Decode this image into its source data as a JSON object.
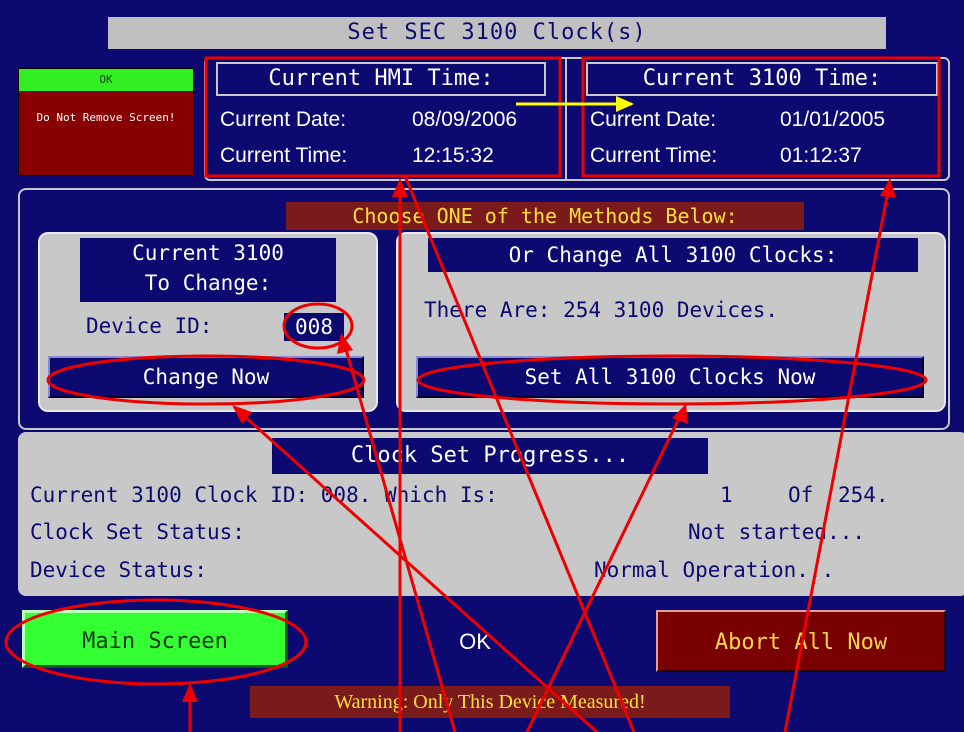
{
  "title": "Set SEC 3100 Clock(s)",
  "status_box": {
    "ok_label": "OK",
    "warning": "Do Not Remove Screen!"
  },
  "hmi_time": {
    "header": "Current HMI Time:",
    "date_label": "Current Date:",
    "date_value": "08/09/2006",
    "time_label": "Current Time:",
    "time_value": "12:15:32"
  },
  "device_time": {
    "header": "Current 3100 Time:",
    "date_label": "Current Date:",
    "date_value": "01/01/2005",
    "time_label": "Current Time:",
    "time_value": "01:12:37"
  },
  "methods": {
    "header": "Choose ONE of the Methods Below:",
    "single": {
      "title_line1": "Current 3100",
      "title_line2": "To Change:",
      "device_id_label": "Device ID:",
      "device_id_value": "008",
      "button": "Change Now"
    },
    "all": {
      "title": "Or Change All 3100 Clocks:",
      "count_text": "There Are: 254 3100 Devices.",
      "button": "Set All 3100 Clocks Now"
    }
  },
  "progress": {
    "header": "Clock Set Progress...",
    "clock_id_label": "Current 3100 Clock ID: 008. Which Is:",
    "current_index": "1",
    "of_label": "Of",
    "total": "254.",
    "status_label": "Clock Set Status:",
    "status_value": "Not started...",
    "device_status_label": "Device Status:",
    "device_status_value": "Normal Operation..."
  },
  "footer": {
    "main_screen_button": "Main Screen",
    "ok_text": "OK",
    "abort_button": "Abort All Now",
    "warning": "Warning: Only This Device Measured!"
  },
  "colors": {
    "background": "#0c0a70",
    "panel_grey": "#c8c8c8",
    "accent_green": "#33ff33",
    "alert_red": "#7a0000",
    "annotation_red": "#ee0000",
    "annotation_yellow": "#ffff00"
  }
}
